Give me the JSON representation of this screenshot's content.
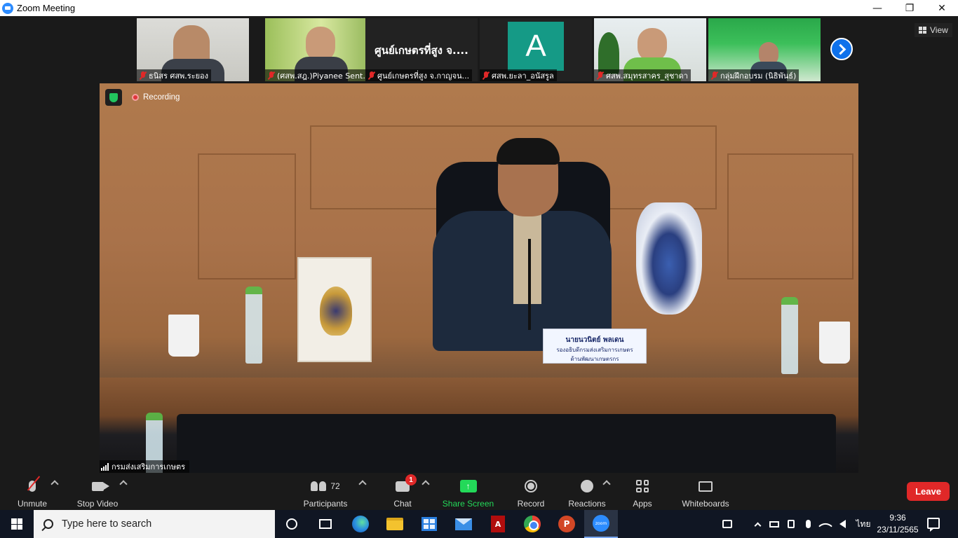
{
  "window": {
    "title": "Zoom Meeting",
    "controls": {
      "minimize": "—",
      "restore": "❐",
      "close": "✕"
    }
  },
  "gallery": {
    "tiles": [
      {
        "name": "ธนิสร ศสพ.ระยอง",
        "type": "video",
        "muted": true
      },
      {
        "name": "(ศสพ.สฎ.)Piyanee Sent...",
        "type": "video",
        "muted": true
      },
      {
        "name": "ศูนย์เกษตรที่สูง จ.กาญจน...",
        "type": "text",
        "display_text": "ศูนย์เกษตรที่สูง จ....",
        "muted": true
      },
      {
        "name": "ศสพ.ยะลา_อนัสรูล",
        "type": "avatar",
        "avatar_letter": "A",
        "avatar_color": "#159a86",
        "muted": true
      },
      {
        "name": "ศสพ.สมุทรสาคร_สุชาดา",
        "type": "video",
        "muted": true
      },
      {
        "name": "กลุ่มฝึกอบรม (นิธิพันธ์)",
        "type": "video",
        "muted": true
      }
    ],
    "view_label": "View",
    "next_icon": "chevron-right-icon"
  },
  "main": {
    "recording_label": "Recording",
    "participant_label": "กรมส่งเสริมการเกษตร",
    "nameplate_line1": "นายนวนิตย์ พลเดน",
    "nameplate_line2": "รองอธิบดีกรมส่งเสริมการเกษตร",
    "nameplate_line3": "ด้านพัฒนาเกษตรกร"
  },
  "toolbar": {
    "unmute_label": "Unmute",
    "stop_video_label": "Stop Video",
    "participants_label": "Participants",
    "participants_count": "72",
    "chat_label": "Chat",
    "chat_badge": "1",
    "share_label": "Share Screen",
    "record_label": "Record",
    "reactions_label": "Reactions",
    "apps_label": "Apps",
    "whiteboards_label": "Whiteboards",
    "leave_label": "Leave",
    "share_icon_glyph": "↑"
  },
  "taskbar": {
    "search_placeholder": "Type here to search",
    "pdf_glyph": "A",
    "ppt_glyph": "P",
    "zoom_glyph": "zoom",
    "language": "ไทย",
    "time": "9:36",
    "date": "23/11/2565"
  },
  "colors": {
    "accent_blue": "#0e71eb",
    "leave_red": "#e02828",
    "share_green": "#23d959",
    "toolbar_bg": "#1a1a1a",
    "taskbar_bg": "#101623"
  }
}
